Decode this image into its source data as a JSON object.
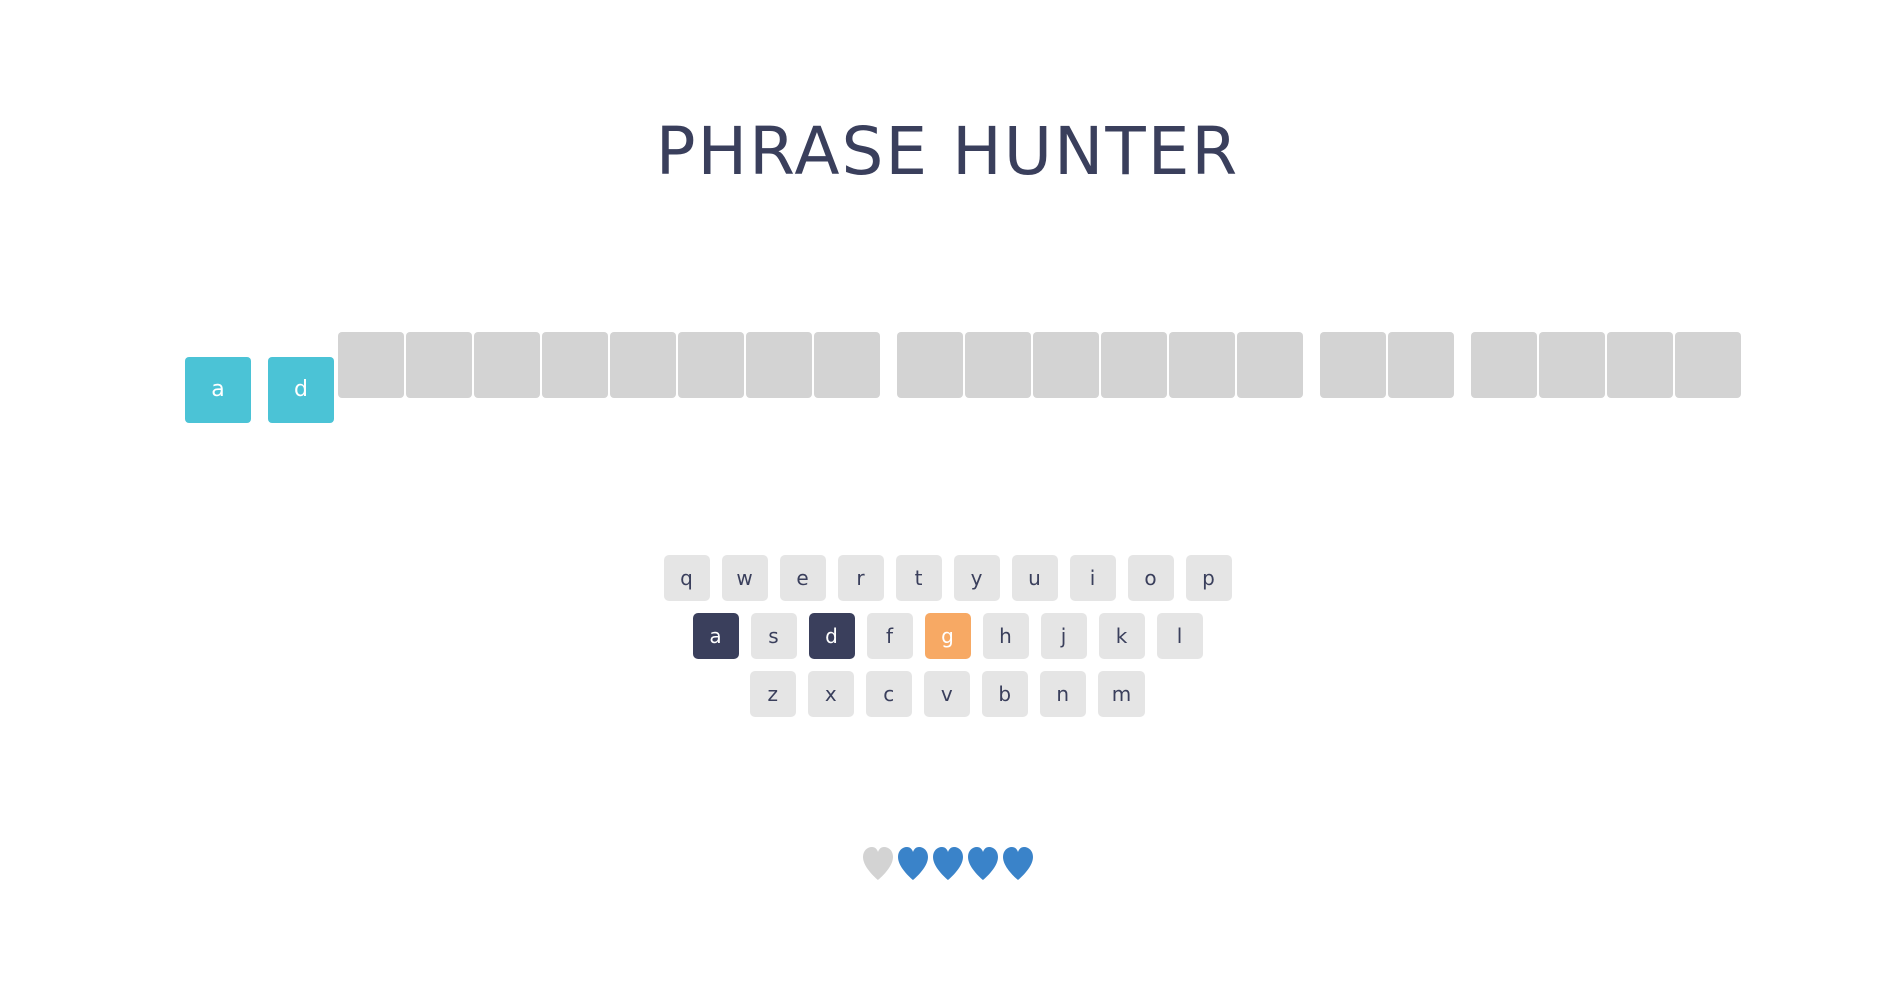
{
  "title": "PHRASE HUNTER",
  "phrase": {
    "letters": [
      {
        "char": "a",
        "shown": true
      },
      {
        "char": "d",
        "shown": true
      },
      {
        "char": "",
        "shown": false
      },
      {
        "char": "",
        "shown": false
      },
      {
        "char": "",
        "shown": false
      },
      {
        "char": "",
        "shown": false
      },
      {
        "char": "",
        "shown": false
      },
      {
        "char": "",
        "shown": false
      },
      {
        "char": "",
        "shown": false
      },
      {
        "char": "",
        "shown": false
      },
      {
        "char": "",
        "shown": false
      },
      {
        "char": "",
        "shown": false
      },
      {
        "char": "",
        "shown": false
      },
      {
        "char": "",
        "shown": false
      },
      {
        "char": "",
        "shown": false
      },
      {
        "char": "",
        "shown": false
      },
      {
        "char": "",
        "shown": false
      },
      {
        "char": "",
        "shown": false
      },
      {
        "char": "",
        "shown": false
      },
      {
        "char": "",
        "shown": false
      },
      {
        "char": "",
        "shown": false
      },
      {
        "char": "",
        "shown": false
      }
    ]
  },
  "keyboard": {
    "rows": [
      [
        {
          "label": "q",
          "state": "default"
        },
        {
          "label": "w",
          "state": "default"
        },
        {
          "label": "e",
          "state": "default"
        },
        {
          "label": "r",
          "state": "default"
        },
        {
          "label": "t",
          "state": "default"
        },
        {
          "label": "y",
          "state": "default"
        },
        {
          "label": "u",
          "state": "default"
        },
        {
          "label": "i",
          "state": "default"
        },
        {
          "label": "o",
          "state": "default"
        },
        {
          "label": "p",
          "state": "default"
        }
      ],
      [
        {
          "label": "a",
          "state": "chosen"
        },
        {
          "label": "s",
          "state": "default"
        },
        {
          "label": "d",
          "state": "chosen"
        },
        {
          "label": "f",
          "state": "default"
        },
        {
          "label": "g",
          "state": "wrong"
        },
        {
          "label": "h",
          "state": "default"
        },
        {
          "label": "j",
          "state": "default"
        },
        {
          "label": "k",
          "state": "default"
        },
        {
          "label": "l",
          "state": "default"
        }
      ],
      [
        {
          "label": "z",
          "state": "default"
        },
        {
          "label": "x",
          "state": "default"
        },
        {
          "label": "c",
          "state": "default"
        },
        {
          "label": "v",
          "state": "default"
        },
        {
          "label": "b",
          "state": "default"
        },
        {
          "label": "n",
          "state": "default"
        },
        {
          "label": "m",
          "state": "default"
        }
      ]
    ]
  },
  "lives": {
    "total": 5,
    "remaining": 4,
    "lost_color": "#d3d3d3",
    "live_color": "#3a83c9",
    "icon": "heart-icon"
  },
  "colors": {
    "title": "#3a3f5c",
    "tile_hidden": "#d3d3d3",
    "tile_shown": "#4bc3d6",
    "key_default": "#e5e5e5",
    "key_chosen": "#3a3f5c",
    "key_wrong": "#f7a964"
  }
}
